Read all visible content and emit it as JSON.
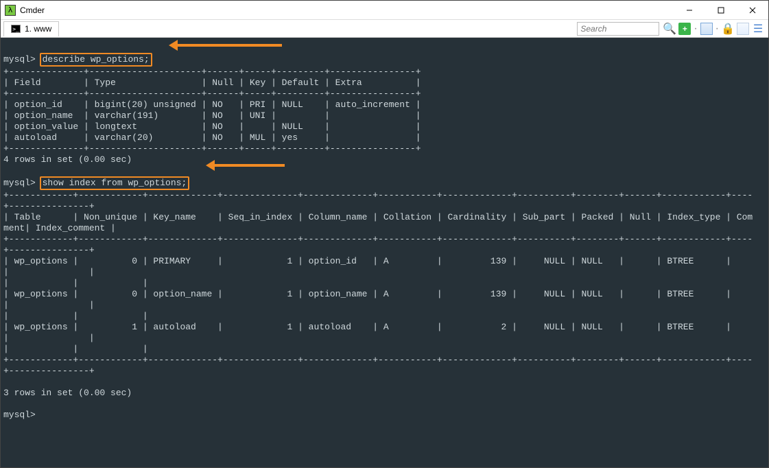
{
  "window": {
    "title": "Cmder"
  },
  "tab": {
    "label": "1. www"
  },
  "toolbar": {
    "search_placeholder": "Search"
  },
  "prompt": "mysql>",
  "cmd1": "describe wp_options;",
  "cmd2": "show index from wp_options;",
  "describe": {
    "cols": [
      "Field",
      "Type",
      "Null",
      "Key",
      "Default",
      "Extra"
    ],
    "rows": [
      {
        "Field": "option_id",
        "Type": "bigint(20) unsigned",
        "Null": "NO",
        "Key": "PRI",
        "Default": "NULL",
        "Extra": "auto_increment"
      },
      {
        "Field": "option_name",
        "Type": "varchar(191)",
        "Null": "NO",
        "Key": "UNI",
        "Default": "",
        "Extra": ""
      },
      {
        "Field": "option_value",
        "Type": "longtext",
        "Null": "NO",
        "Key": "",
        "Default": "NULL",
        "Extra": ""
      },
      {
        "Field": "autoload",
        "Type": "varchar(20)",
        "Null": "NO",
        "Key": "MUL",
        "Default": "yes",
        "Extra": ""
      }
    ],
    "footer": "4 rows in set (0.00 sec)"
  },
  "index": {
    "cols": [
      "Table",
      "Non_unique",
      "Key_name",
      "Seq_in_index",
      "Column_name",
      "Collation",
      "Cardinality",
      "Sub_part",
      "Packed",
      "Null",
      "Index_type",
      "Comment",
      "Index_comment"
    ],
    "rows": [
      {
        "Table": "wp_options",
        "Non_unique": 0,
        "Key_name": "PRIMARY",
        "Seq_in_index": 1,
        "Column_name": "option_id",
        "Collation": "A",
        "Cardinality": 139,
        "Sub_part": "NULL",
        "Packed": "NULL",
        "Null": "",
        "Index_type": "BTREE",
        "Comment": "",
        "Index_comment": ""
      },
      {
        "Table": "wp_options",
        "Non_unique": 0,
        "Key_name": "option_name",
        "Seq_in_index": 1,
        "Column_name": "option_name",
        "Collation": "A",
        "Cardinality": 139,
        "Sub_part": "NULL",
        "Packed": "NULL",
        "Null": "",
        "Index_type": "BTREE",
        "Comment": "",
        "Index_comment": ""
      },
      {
        "Table": "wp_options",
        "Non_unique": 1,
        "Key_name": "autoload",
        "Seq_in_index": 1,
        "Column_name": "autoload",
        "Collation": "A",
        "Cardinality": 2,
        "Sub_part": "NULL",
        "Packed": "NULL",
        "Null": "",
        "Index_type": "BTREE",
        "Comment": "",
        "Index_comment": ""
      }
    ],
    "footer": "3 rows in set (0.00 sec)"
  },
  "colors": {
    "terminal_bg": "#263138",
    "terminal_fg": "#cfd8dc",
    "accent": "#f08a24"
  }
}
